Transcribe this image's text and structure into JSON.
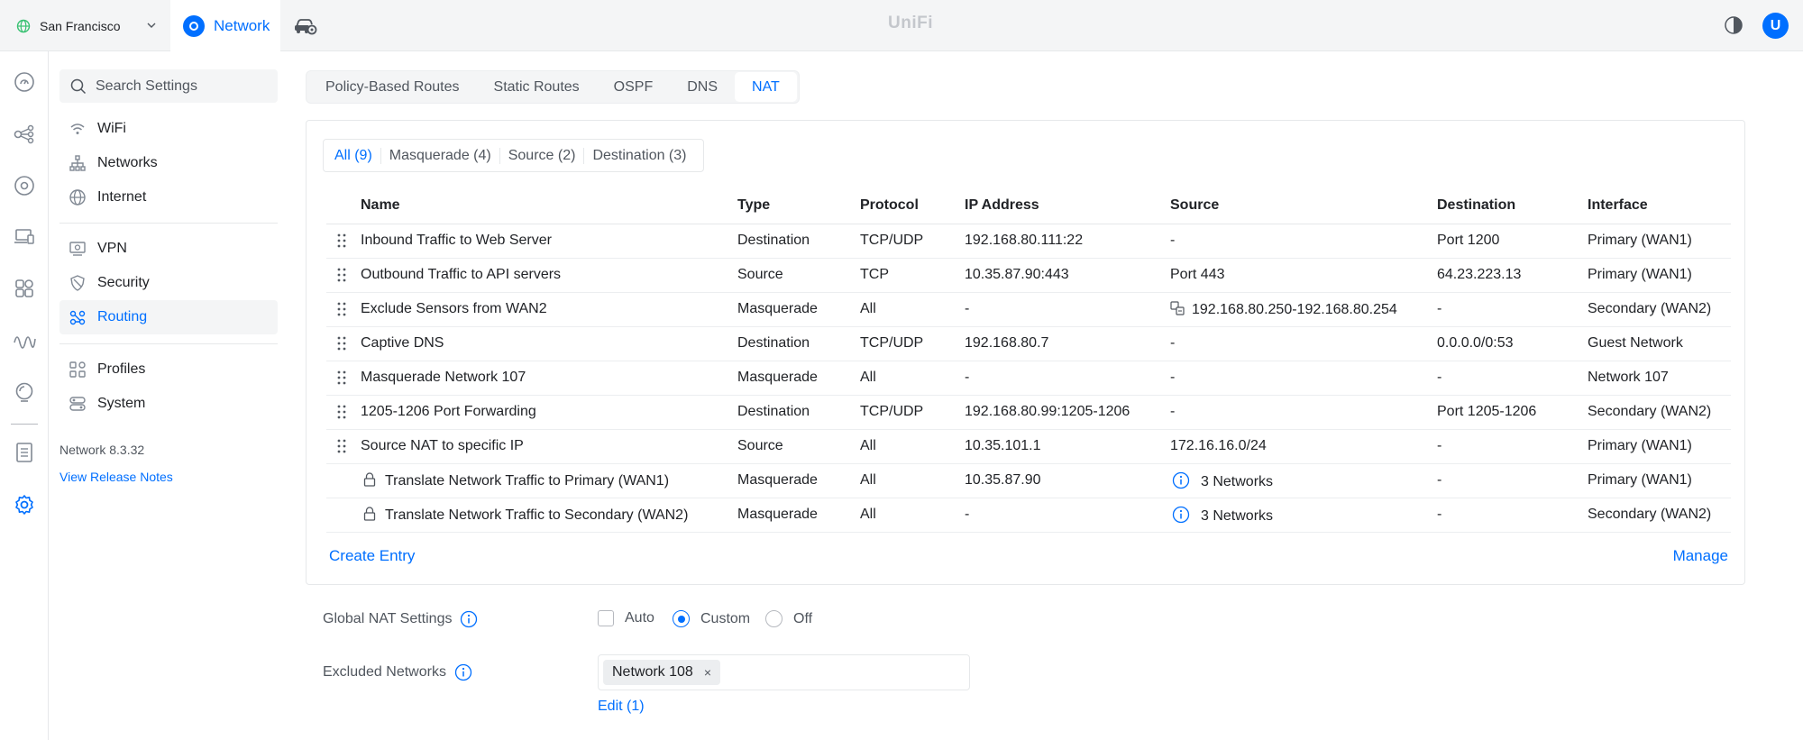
{
  "topbar": {
    "site": "San Francisco",
    "app": "Network",
    "brand": "UniFi",
    "user_initial": "U",
    "icons": {
      "site": "globe-icon",
      "site_chevron": "chevron-down-icon",
      "app": "network-app-icon",
      "secondary_app": "car-gear-icon",
      "theme": "theme-toggle-icon"
    },
    "accent": "#006fff"
  },
  "rail": [
    "dashboard-icon",
    "topology-icon",
    "unifi-devices-icon",
    "client-devices-icon",
    "apps-icon",
    "insights-icon",
    "radar-icon",
    "system-log-icon",
    "settings-icon"
  ],
  "sidebar": {
    "search_placeholder": "Search Settings",
    "items": [
      {
        "label": "WiFi",
        "icon": "wifi-icon"
      },
      {
        "label": "Networks",
        "icon": "networks-icon"
      },
      {
        "label": "Internet",
        "icon": "internet-globe-icon"
      },
      {
        "label": "VPN",
        "icon": "vpn-icon"
      },
      {
        "label": "Security",
        "icon": "shield-icon"
      },
      {
        "label": "Routing",
        "icon": "routing-icon"
      },
      {
        "label": "Profiles",
        "icon": "profiles-icon"
      },
      {
        "label": "System",
        "icon": "system-icon"
      }
    ],
    "version": "Network 8.3.32",
    "release_notes": "View Release Notes"
  },
  "tabs": [
    "Policy-Based Routes",
    "Static Routes",
    "OSPF",
    "DNS",
    "NAT"
  ],
  "filters": [
    "All (9)",
    "Masquerade (4)",
    "Source (2)",
    "Destination (3)"
  ],
  "table": {
    "headers": [
      "Name",
      "Type",
      "Protocol",
      "IP Address",
      "Source",
      "Destination",
      "Interface"
    ],
    "rows": [
      {
        "name": "Inbound Traffic to Web Server",
        "type": "Destination",
        "protocol": "TCP/UDP",
        "ip": "192.168.80.111:22",
        "source": "-",
        "destination": "Port 1200",
        "interface": "Primary (WAN1)"
      },
      {
        "name": "Outbound Traffic to API servers",
        "type": "Source",
        "protocol": "TCP",
        "ip": "10.35.87.90:443",
        "source": "Port 443",
        "destination": "64.23.223.13",
        "interface": "Primary (WAN1)"
      },
      {
        "name": "Exclude Sensors from WAN2",
        "type": "Masquerade",
        "protocol": "All",
        "ip": "-",
        "source": "192.168.80.250-192.168.80.254",
        "destination": "-",
        "interface": "Secondary (WAN2)"
      },
      {
        "name": "Captive DNS",
        "type": "Destination",
        "protocol": "TCP/UDP",
        "ip": "192.168.80.7",
        "source": "-",
        "destination": "0.0.0.0/0:53",
        "interface": "Guest Network"
      },
      {
        "name": "Masquerade Network 107",
        "type": "Masquerade",
        "protocol": "All",
        "ip": "-",
        "source": "-",
        "destination": "-",
        "interface": "Network 107"
      },
      {
        "name": "1205-1206 Port Forwarding",
        "type": "Destination",
        "protocol": "TCP/UDP",
        "ip": "192.168.80.99:1205-1206",
        "source": "-",
        "destination": "Port 1205-1206",
        "interface": "Secondary (WAN2)"
      },
      {
        "name": "Source NAT to specific IP",
        "type": "Source",
        "protocol": "All",
        "ip": "10.35.101.1",
        "source": "172.16.16.0/24",
        "destination": "-",
        "interface": "Primary (WAN1)"
      },
      {
        "name": "Translate Network Traffic to Primary (WAN1)",
        "type": "Masquerade",
        "protocol": "All",
        "ip": "10.35.87.90",
        "source": "3 Networks",
        "destination": "-",
        "interface": "Primary (WAN1)"
      },
      {
        "name": "Translate Network Traffic to Secondary (WAN2)",
        "type": "Masquerade",
        "protocol": "All",
        "ip": "-",
        "source": "3 Networks",
        "destination": "-",
        "interface": "Secondary (WAN2)"
      }
    ]
  },
  "actions": {
    "create": "Create Entry",
    "manage": "Manage"
  },
  "global_nat": {
    "label": "Global NAT Settings",
    "options": [
      "Auto",
      "Custom",
      "Off"
    ],
    "selected": "Custom"
  },
  "excluded": {
    "label": "Excluded Networks",
    "chip": "Network 108",
    "chip_remove": "×",
    "edit": "Edit (1)"
  }
}
